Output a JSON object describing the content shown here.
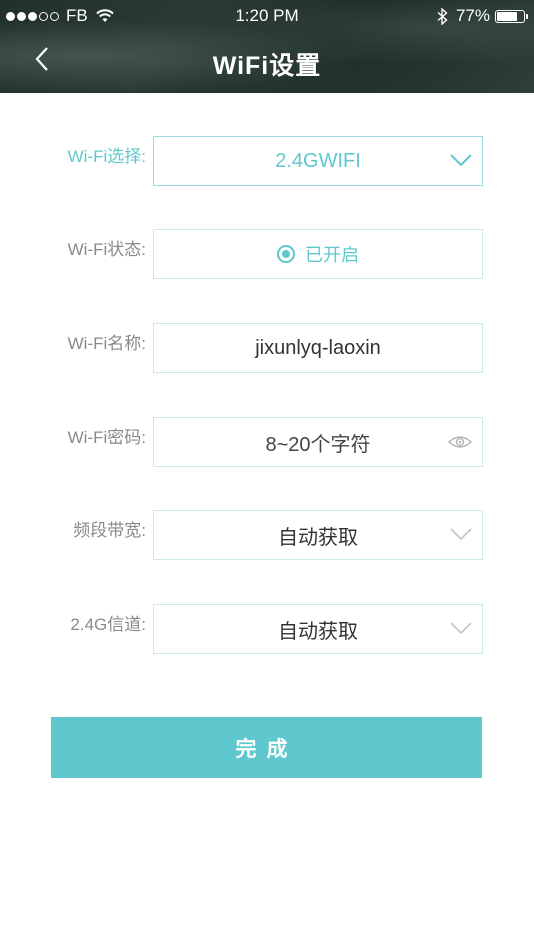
{
  "status_bar": {
    "carrier": "FB",
    "time": "1:20 PM",
    "battery_text": "77%",
    "battery_level": 0.77,
    "signal_bars_filled": 3,
    "signal_bars_total": 5
  },
  "header": {
    "title": "WiFi设置",
    "back_icon": "chevron-left-icon"
  },
  "form": {
    "wifi_select": {
      "label": "Wi-Fi选择:",
      "value": "2.4GWIFI",
      "icon": "chevron-down-icon"
    },
    "wifi_status": {
      "label": "Wi-Fi状态:",
      "value": "已开启",
      "icon": "radio-selected-icon"
    },
    "wifi_name": {
      "label": "Wi-Fi名称:",
      "value": "jixunlyq-laoxin"
    },
    "wifi_password": {
      "label": "Wi-Fi密码:",
      "placeholder": "8~20个字符",
      "icon": "eye-icon"
    },
    "bandwidth": {
      "label": "频段带宽:",
      "value": "自动获取",
      "icon": "chevron-down-icon"
    },
    "channel": {
      "label": "2.4G信道:",
      "value": "自动获取",
      "icon": "chevron-down-icon"
    }
  },
  "submit_label": "完成",
  "colors": {
    "accent": "#5fc8ce",
    "field_border": "#c9e9ec",
    "label_gray": "#8a8a8a",
    "header_dark": "#2b3a35"
  }
}
